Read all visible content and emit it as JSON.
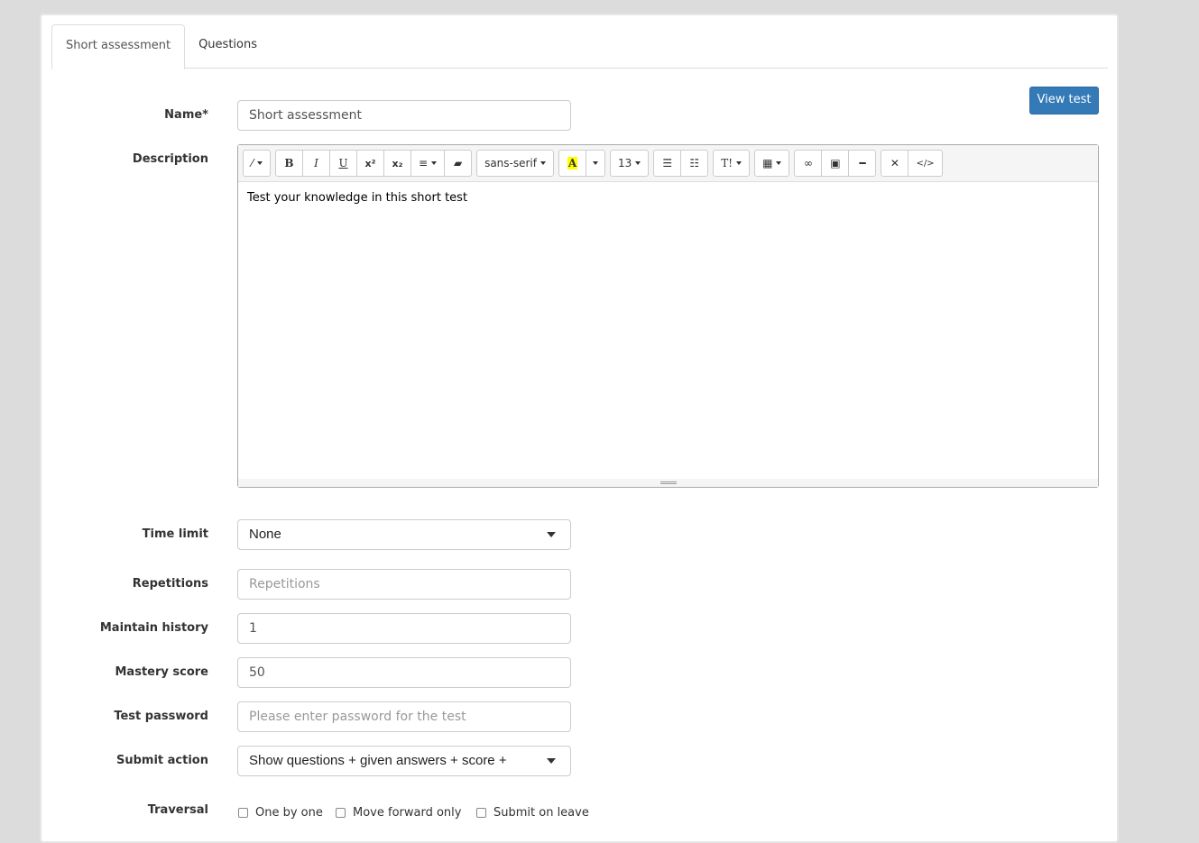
{
  "tabs": [
    {
      "label": "Short assessment",
      "active": true
    },
    {
      "label": "Questions",
      "active": false
    }
  ],
  "view_test_label": "View test",
  "accent": "#337ab7",
  "fields": {
    "name": {
      "label": "Name*",
      "value": "Short assessment"
    },
    "description": {
      "label": "Description",
      "value": "Test your knowledge in this short test"
    },
    "time_limit": {
      "label": "Time limit",
      "value": "None"
    },
    "repetitions": {
      "label": "Repetitions",
      "placeholder": "Repetitions"
    },
    "maintain_history": {
      "label": "Maintain history",
      "value": "1"
    },
    "mastery_score": {
      "label": "Mastery score",
      "value": "50"
    },
    "test_password": {
      "label": "Test password",
      "placeholder": "Please enter password for the test"
    },
    "submit_action": {
      "label": "Submit action",
      "value": "Show questions + given answers + score +"
    },
    "traversal": {
      "label": "Traversal",
      "options": [
        {
          "label": "One by one",
          "checked": false
        },
        {
          "label": "Move forward only",
          "checked": false
        },
        {
          "label": "Submit on leave",
          "checked": false
        }
      ]
    }
  },
  "toolbar": {
    "font": "sans-serif",
    "size": "13",
    "bold": "B",
    "italic": "I",
    "underline": "U",
    "superscript": "x²",
    "subscript": "x₂",
    "color": "A",
    "textstyle": "T!",
    "code": "</>"
  }
}
